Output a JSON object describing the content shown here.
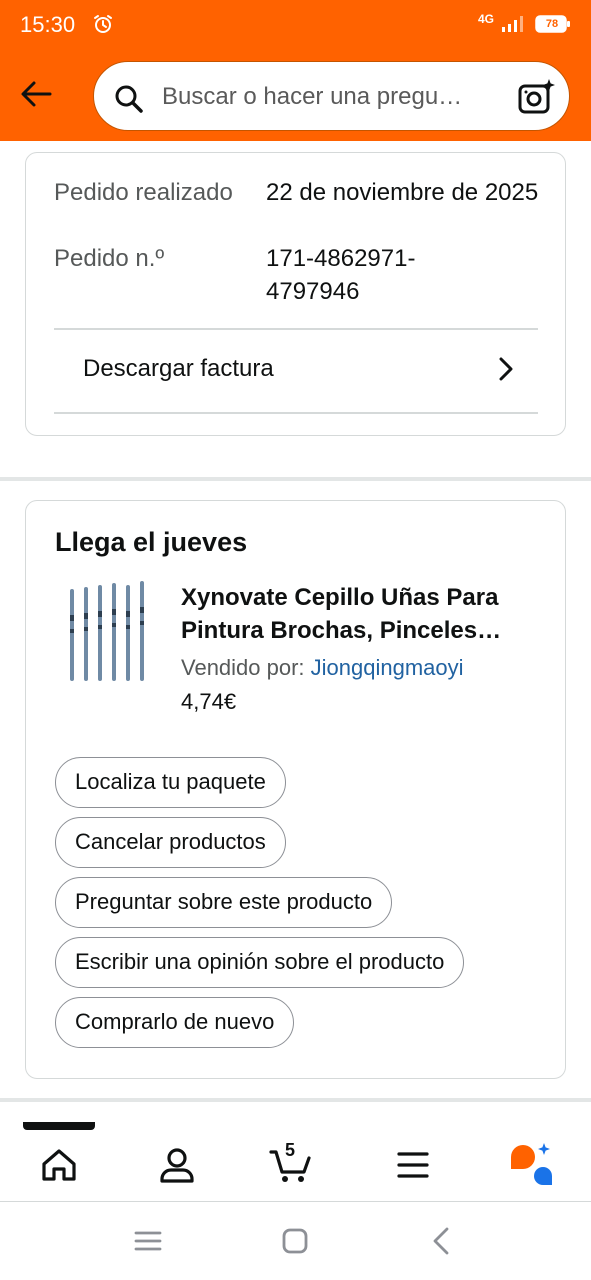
{
  "status_bar": {
    "time": "15:30",
    "network": "4G",
    "battery": "78"
  },
  "header": {
    "search_placeholder": "Buscar o hacer una pregu…",
    "icons": [
      "back-arrow-icon",
      "search-icon",
      "camera-sparkle-icon"
    ]
  },
  "order": {
    "placed_label": "Pedido realizado",
    "placed_value": "22 de noviembre de 2025",
    "number_label": "Pedido n.º",
    "number_value": "171-4862971-4797946",
    "invoice_label": "Descargar factura"
  },
  "delivery": {
    "title": "Llega el jueves",
    "product_title": "Xynovate Cepillo Uñas Para Pintura Brochas, Pinceles…",
    "seller_prefix": "Vendido por: ",
    "seller_name": "Jiongqingmaoyi",
    "price": "4,74€",
    "actions": [
      "Localiza tu paquete",
      "Cancelar productos",
      "Preguntar sobre este producto",
      "Escribir una opinión sobre el producto",
      "Comprarlo de nuevo"
    ]
  },
  "tab_bar": {
    "cart_count": "5",
    "tabs": [
      "home-icon",
      "account-icon",
      "cart-icon",
      "menu-icon",
      "rufus-ai-icon"
    ]
  },
  "colors": {
    "brand_orange": "#ff6200",
    "link_blue": "#2162a1",
    "border_gray": "#d5d9d9"
  }
}
